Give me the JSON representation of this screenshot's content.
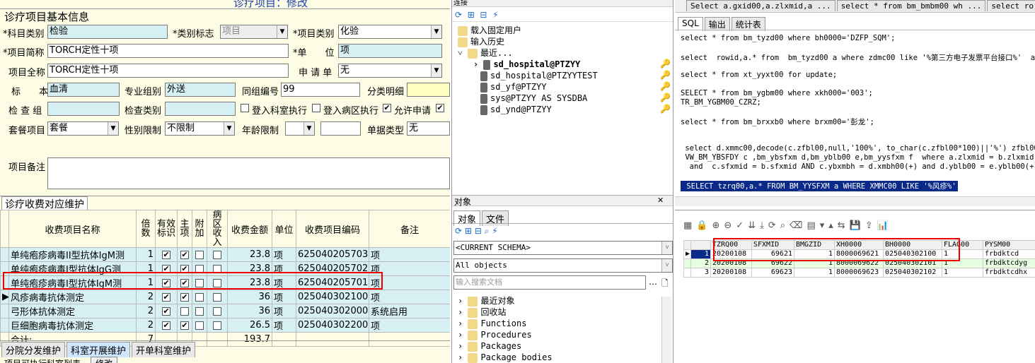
{
  "window": {
    "title_top": "诊疗项目：修改"
  },
  "basic": {
    "section_title": "诊疗项目基本信息",
    "subject_label": "*科目类别",
    "subject_value": "检验",
    "category_flag_label": "*类别标志",
    "category_flag_value": "项目",
    "item_category_label": "*项目类别",
    "item_category_value": "化验",
    "short_name_label": "*项目简称",
    "short_name_value": "TORCH定性十项",
    "unit_label": "*单　　位",
    "unit_value": "项",
    "full_name_label": "项目全称",
    "full_name_value": "TORCH定性十项",
    "apply_form_label": "申 请 单",
    "apply_form_value": "无",
    "specimen_label": "标　　本",
    "specimen_value": "血清",
    "specialty_group_label": "专业组别",
    "specialty_group_value": "外送",
    "same_group_label": "同组编号",
    "same_group_value": "99",
    "class_detail_label": "分类明细",
    "class_detail_value": "",
    "check_group_label": "检 查 组",
    "check_group_value": "",
    "check_type_label": "检查类别",
    "check_type_value": "",
    "dept_exec_label": "登入科室执行",
    "ward_exec_label": "登入病区执行",
    "allow_apply_label": "允许申请",
    "package_label": "套餐项目",
    "package_value": "套餐",
    "gender_label": "性别限制",
    "gender_value": "不限制",
    "age_label": "年龄限制",
    "age_value": "",
    "form_type_label": "单据类型",
    "form_type_value": "无",
    "remark_label": "项目备注",
    "remark_value": ""
  },
  "fee": {
    "section_title": "诊疗收费对应维护",
    "headers": [
      "收费项目名称",
      "倍数",
      "有效标识",
      "主项",
      "附加",
      "病区收入",
      "收费金额",
      "单位",
      "收费项目编码",
      "备注"
    ],
    "rows": [
      {
        "name": "单纯疱疹病毒II型抗体IgM测",
        "mult": "1",
        "valid": true,
        "main": true,
        "extra": false,
        "ward": false,
        "amount": "23.8",
        "unit": "项",
        "code": "625040205703",
        "note": "项"
      },
      {
        "name": "单纯疱疹病毒I型抗体IgG测",
        "mult": "1",
        "valid": true,
        "main": true,
        "extra": false,
        "ward": false,
        "amount": "23.8",
        "unit": "项",
        "code": "625040205702",
        "note": "项"
      },
      {
        "name": "单纯疱疹病毒I型抗体IgM测",
        "mult": "1",
        "valid": true,
        "main": true,
        "extra": false,
        "ward": false,
        "amount": "23.8",
        "unit": "项",
        "code": "625040205701",
        "note": "项"
      },
      {
        "name": "风疹病毒抗体测定",
        "mult": "2",
        "valid": true,
        "main": true,
        "extra": false,
        "ward": false,
        "amount": "36",
        "unit": "项",
        "code": "025040302100",
        "note": "项"
      },
      {
        "name": "弓形体抗体测定",
        "mult": "2",
        "valid": true,
        "main": false,
        "extra": false,
        "ward": false,
        "amount": "36",
        "unit": "项",
        "code": "025040302000",
        "note": "系统启用"
      },
      {
        "name": "巨细胞病毒抗体测定",
        "mult": "2",
        "valid": true,
        "main": true,
        "extra": false,
        "ward": false,
        "amount": "26.5",
        "unit": "项",
        "code": "025040302200",
        "note": "项"
      }
    ],
    "total_label": "合计:",
    "total_mult": "7",
    "total_amount": "193.7"
  },
  "bottom_tabs": [
    "分院分发维护",
    "科室开展维护",
    "开单科室维护"
  ],
  "bottom_row": {
    "label": "项目可执行科室列表",
    "button": "修改"
  },
  "conn": {
    "title": "连接",
    "items": [
      "载入固定用户",
      "输入历史",
      "最近..."
    ],
    "recent": [
      "sd_hospital@PTZYY",
      "sd_hospital@PTZYYTEST",
      "sd_yf@PTZYY",
      "sys@PTZYY AS SYSDBA",
      "sd_ynd@PTZYY"
    ]
  },
  "objects": {
    "title": "对象",
    "tabs": [
      "对象",
      "文件"
    ],
    "schema": "<CURRENT SCHEMA>",
    "filter": "All objects",
    "search_placeholder": "输入搜索文档",
    "tree": [
      "最近对象",
      "回收站",
      "Functions",
      "Procedures",
      "Packages",
      "Package bodies"
    ]
  },
  "editor": {
    "doc_tabs": [
      "Select a.gxid00,a.zlxmid,a ...",
      "select * from bm_bmbm00 wh ...",
      "select ro"
    ],
    "sub_tabs": [
      "SQL",
      "输出",
      "统计表"
    ],
    "lines": [
      "select * from bm_tyzd00 where bh0000='DZFP_SQM';",
      "select  rowid,a.* from  bm_tyzd00 a where zdmc00 like '%第三方电子发票平台接口%'  an",
      "select * from xt_yyxt00 for update;",
      "SELECT * from bm_ygbm00 where xkh000='003';",
      "TR_BM_YGBM00_CZRZ;",
      "select * from bm_brxxb0 where brxm00='彭龙';",
      " select d.xmmc00,decode(c.zfbl00,null,'100%', to_char(c.zfbl00*100)||'%') zfbl00str,",
      " VW_BM_YBSFDY c ,bm_ybsfxm d,bm_yblb00 e,bm_yysfxm f  where a.zlxmid = b.zlxmid",
      "  and  c.sfxmid = b.sfxmid AND c.ybxmbh = d.xmbh00(+) and d.yblb00 = e.yblb00(+)  an",
      " SELECT tzrq00,a.* FROM BM_YYSFXM a WHERE XMMC00 LIKE '%风疹%'"
    ]
  },
  "results": {
    "headers": [
      "TZRQ00",
      "SFXMID",
      "BMGZID",
      "XH0000",
      "BH0000",
      "FLAG00",
      "PYSM00"
    ],
    "rows": [
      [
        "1",
        "20200108",
        "69621",
        "1",
        "8000069621",
        "025040302100",
        "1",
        "frbdktcd"
      ],
      [
        "2",
        "20200108",
        "69622",
        "1",
        "8000069622",
        "025040302101",
        "1",
        "frbdktcdyg"
      ],
      [
        "3",
        "20200108",
        "69623",
        "1",
        "8000069623",
        "025040302102",
        "1",
        "frbdktcdhx"
      ]
    ]
  }
}
